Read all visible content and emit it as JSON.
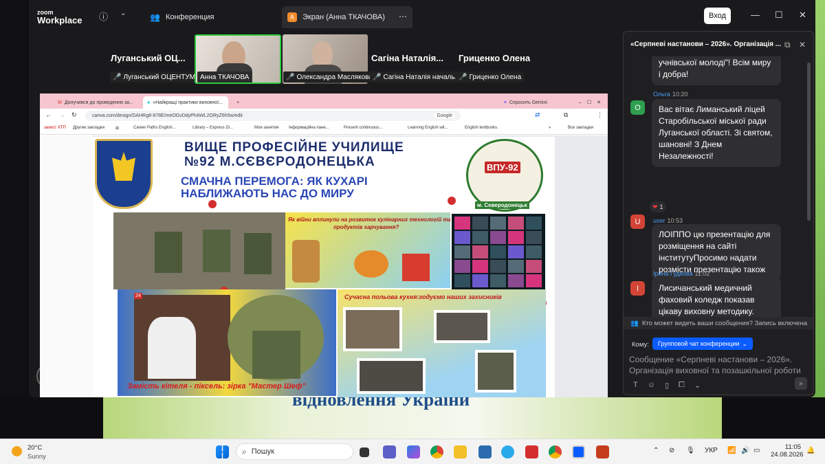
{
  "zoom": {
    "logo_line1": "zoom",
    "logo_line2": "Workplace",
    "tab_conference": "Конференция",
    "tab_screen": "Экран (Анна ТКАЧОВА)",
    "tab_screen_icon_letter": "А",
    "enter_button": "Вход"
  },
  "participants": [
    {
      "name": "Луганський ОЦ...",
      "tag": "Луганський ОЦЕНТУМ"
    },
    {
      "tag": "Анна ТКАЧОВА",
      "active": true
    },
    {
      "tag": "Олександра Маслякова"
    },
    {
      "name": "Сагіна Наталія...",
      "tag": "Сагіна Наталія началь..."
    },
    {
      "name": "Гриценко Олена",
      "tag": "Гриценко Олена"
    }
  ],
  "browser": {
    "tabs": [
      "Долучився до проведення за...",
      "«Найкращі практики виховної...",
      "Спросить Gemini"
    ],
    "url": "canva.com/design/DAHRg8-878E/meOGvDdyPhAWL2ORyZ6h5w/edit",
    "search_engine": "Google",
    "bookmarks": [
      "захист ХТП",
      "Другие закладки",
      "Career Paths English...",
      "Library – Express Di...",
      "Мои занятия",
      "Інформаційна пане...",
      "Present continuous...",
      "Learning English wit...",
      "English textbooks.",
      "Все закладки"
    ]
  },
  "slide": {
    "title_l1": "ВИЩЕ ПРОФЕСІЙНЕ УЧИЛИЩЕ",
    "title_l2": "№92 М.СЄВЄРОДОНЕЦЬКА",
    "sub_l1": "СМАЧНА ПЕРЕМОГА: ЯК КУХАРІ",
    "sub_l2": "НАБЛИЖАЮТЬ НАС ДО МИРУ",
    "badge_title": "ВПУ-92",
    "badge_bottom": "м. Северодонецьк",
    "war_question_l1": "Як війни вплинули на розвиток кулінарних технологій та",
    "war_question_l2": "продуктів харчування?",
    "field_kitchen": "Сучасна польова кухня:годуємо наших захисників",
    "caption": "Замість кітеля - піксель: зірка \"Мастер Шеф\"",
    "bg_caption": "відновлення України"
  },
  "chat": {
    "title": "«Серпневі настанови – 2026». Організація ...",
    "messages": [
      {
        "text": "учнівської молоді\"! Всім миру і добра!"
      },
      {
        "sender": "Ольга",
        "time": "10:20",
        "avatar": "О",
        "avatar_color": "#2e9e4f",
        "text": "Вас вітає Лиманський ліцей Старобільської міської ради Луганської області. Зі святом, шановні! З Днем Незалежності!"
      },
      {
        "sender": "user",
        "time": "10:53",
        "avatar": "U",
        "avatar_color": "#d24536",
        "text": "ЛОІППО цю презентацію для розміщення на сайті інститутуПросимо надати розмісти презентацію також"
      },
      {
        "sender": "Ірина Гудкова",
        "time": "11:02",
        "avatar": "I",
        "avatar_color": "#d24536",
        "text": "Лисичанський медичний фаховий коледж показав цікаву виховну методику. Дякуємо за досвід!!!!"
      }
    ],
    "reaction_count": "1",
    "visibility_note": "Кто может видеть ваши сообщения? Запись включена",
    "to_label": "Кому:",
    "to_value": "Групповой чат конференции",
    "input_placeholder": "Сообщение «Серпневі настанови – 2026». Організація виховної та позашкільної роботи"
  },
  "taskbar": {
    "temp": "20°C",
    "weather": "Sunny",
    "search": "Пошук",
    "lang": "УКР",
    "time": "11:05",
    "date": "24.08.2026"
  }
}
